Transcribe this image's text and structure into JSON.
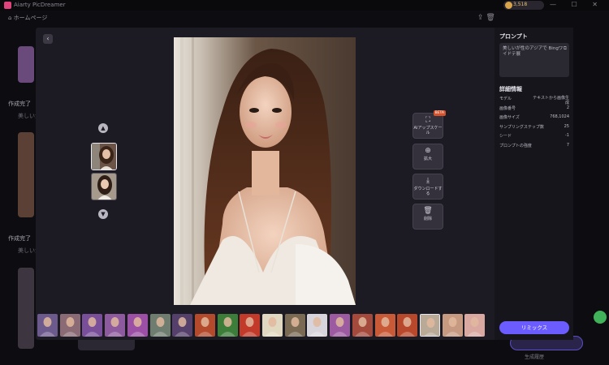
{
  "app": {
    "title": "Aiarty PicDreamer",
    "home_label": "ホームページ",
    "credits": "3,518",
    "window_controls": "— ☐ ✕"
  },
  "background": {
    "section1": "作成完了",
    "section1_sub": "美しいが",
    "section2": "作成完了",
    "section2_sub": "美しいが",
    "right_button_label": "生成 (開)",
    "right_small": "生成履歴"
  },
  "modal": {
    "back_icon": "chevron-left-icon",
    "tools": [
      {
        "label": "AIアップスケール",
        "icon": "upscale-icon",
        "badge": "BETA"
      },
      {
        "label": "拡大",
        "icon": "zoom-in-icon"
      },
      {
        "label": "ダウンロードする",
        "icon": "download-icon"
      },
      {
        "label": "削除",
        "icon": "trash-icon"
      }
    ]
  },
  "panel": {
    "prompt_heading": "プロンプト",
    "prompt_text": "美しいが性のアジアで Bingワイドテ展",
    "details_heading": "詳細情報",
    "details": [
      {
        "key": "モデル",
        "value": "テキストから画像生成"
      },
      {
        "key": "画像番号",
        "value": "2"
      },
      {
        "key": "画像サイズ",
        "value": "768,1024"
      },
      {
        "key": "サンプリングステップ数",
        "value": "25"
      },
      {
        "key": "シード",
        "value": "-1"
      },
      {
        "key": "プロンプトの強度",
        "value": "7"
      }
    ],
    "remix_label": "リミックス"
  },
  "filmstrip": {
    "count": 20,
    "selected_index": 17,
    "colors": [
      "#6d5a8c",
      "#8a6a74",
      "#7a4f9a",
      "#8e5a9e",
      "#9b4fa5",
      "#6f7c70",
      "#54406a",
      "#b34a2c",
      "#3d7d3a",
      "#c23b2a",
      "#e0d8c0",
      "#7a6a54",
      "#d8d4dc",
      "#9c5aa0",
      "#a44a3c",
      "#c85a38",
      "#b8482c",
      "#b9aa98",
      "#c69a80",
      "#d9a8a0"
    ]
  }
}
